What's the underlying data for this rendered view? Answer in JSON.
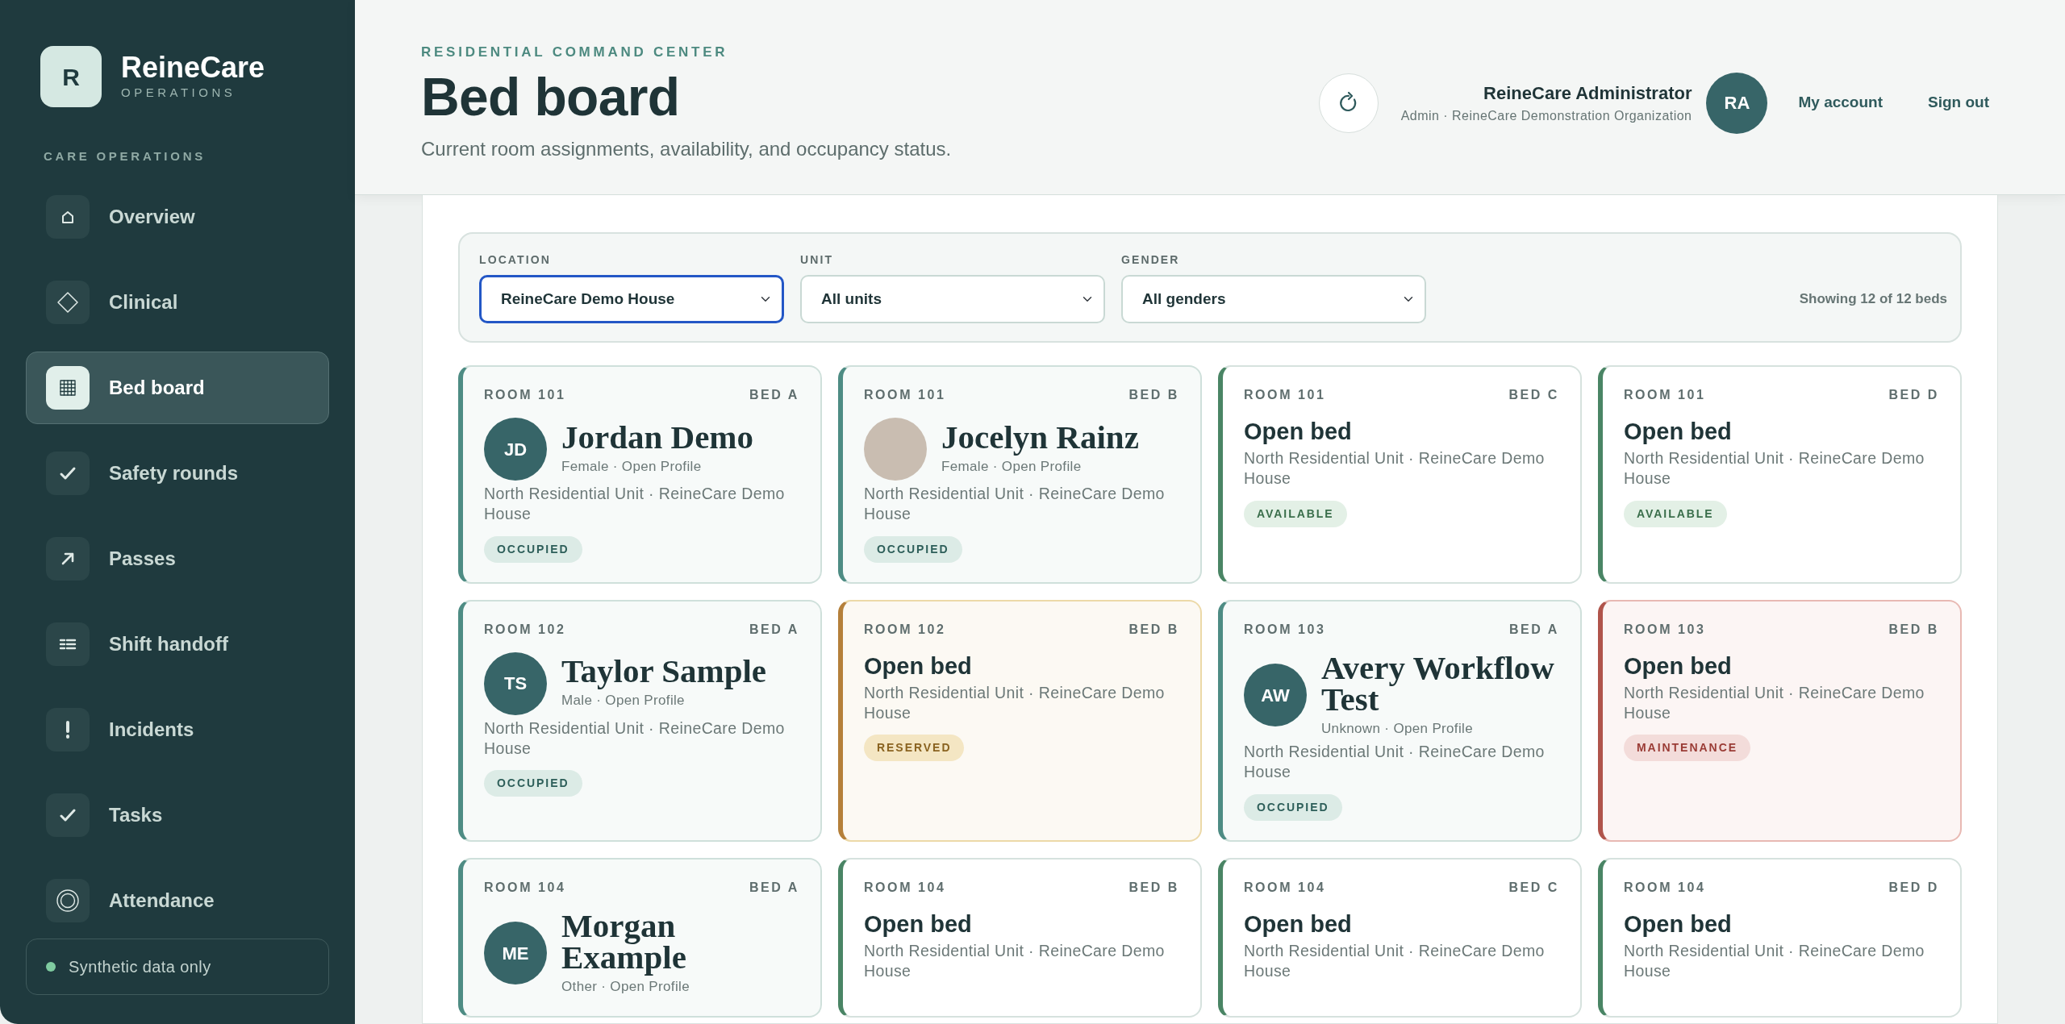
{
  "sidebar": {
    "brand": {
      "initial": "R",
      "name": "ReineCare",
      "tagline": "OPERATIONS"
    },
    "section_label": "CARE OPERATIONS",
    "items": [
      {
        "label": "Overview",
        "selected": false
      },
      {
        "label": "Clinical",
        "selected": false
      },
      {
        "label": "Bed board",
        "selected": true
      },
      {
        "label": "Safety rounds",
        "selected": false
      },
      {
        "label": "Passes",
        "selected": false
      },
      {
        "label": "Shift handoff",
        "selected": false
      },
      {
        "label": "Incidents",
        "selected": false
      },
      {
        "label": "Tasks",
        "selected": false
      },
      {
        "label": "Attendance",
        "selected": false
      }
    ],
    "footer": "Synthetic data only"
  },
  "header": {
    "eyebrow": "RESIDENTIAL COMMAND CENTER",
    "title": "Bed board",
    "subtitle": "Current room assignments, availability, and occupancy status.",
    "user": {
      "name": "ReineCare Administrator",
      "role": "Admin · ReineCare Demonstration Organization",
      "initials": "RA"
    },
    "links": [
      "My account",
      "Sign out"
    ]
  },
  "filters": [
    {
      "label": "LOCATION",
      "value": "ReineCare Demo House",
      "focused": true
    },
    {
      "label": "UNIT",
      "value": "All units",
      "focused": false
    },
    {
      "label": "GENDER",
      "value": "All genders",
      "focused": false
    }
  ],
  "count_text": "Showing 12 of 12 beds",
  "beds": [
    {
      "room": "ROOM 101",
      "bed": "BED A",
      "kind": "occupied",
      "occupant": {
        "name": "Jordan Demo",
        "details": "Female · Open Profile",
        "avatar": {
          "kind": "initials",
          "initials": "JD"
        }
      },
      "location": "North Residential Unit · ReineCare Demo House",
      "badge": "OCCUPIED"
    },
    {
      "room": "ROOM 101",
      "bed": "BED B",
      "kind": "occupied",
      "occupant": {
        "name": "Jocelyn Rainz",
        "details": "Female · Open Profile",
        "avatar": {
          "kind": "photo"
        }
      },
      "location": "North Residential Unit · ReineCare Demo House",
      "badge": "OCCUPIED"
    },
    {
      "room": "ROOM 101",
      "bed": "BED C",
      "kind": "available",
      "title": "Open bed",
      "location": "North Residential Unit · ReineCare Demo House",
      "badge": "AVAILABLE"
    },
    {
      "room": "ROOM 101",
      "bed": "BED D",
      "kind": "available",
      "title": "Open bed",
      "location": "North Residential Unit · ReineCare Demo House",
      "badge": "AVAILABLE"
    },
    {
      "room": "ROOM 102",
      "bed": "BED A",
      "kind": "occupied",
      "occupant": {
        "name": "Taylor Sample",
        "details": "Male · Open Profile",
        "avatar": {
          "kind": "initials",
          "initials": "TS"
        }
      },
      "location": "North Residential Unit · ReineCare Demo House",
      "badge": "OCCUPIED"
    },
    {
      "room": "ROOM 102",
      "bed": "BED B",
      "kind": "reserved",
      "title": "Open bed",
      "location": "North Residential Unit · ReineCare Demo House",
      "badge": "RESERVED"
    },
    {
      "room": "ROOM 103",
      "bed": "BED A",
      "kind": "occupied",
      "occupant": {
        "name": "Avery Workflow Test",
        "details": "Unknown · Open Profile",
        "avatar": {
          "kind": "initials",
          "initials": "AW"
        }
      },
      "location": "North Residential Unit · ReineCare Demo House",
      "badge": "OCCUPIED"
    },
    {
      "room": "ROOM 103",
      "bed": "BED B",
      "kind": "maintenance",
      "title": "Open bed",
      "location": "North Residential Unit · ReineCare Demo House",
      "badge": "MAINTENANCE"
    },
    {
      "room": "ROOM 104",
      "bed": "BED A",
      "kind": "occupied",
      "occupant": {
        "name": "Morgan Example",
        "details": "Other · Open Profile",
        "avatar": {
          "kind": "initials",
          "initials": "ME"
        }
      }
    },
    {
      "room": "ROOM 104",
      "bed": "BED B",
      "kind": "available",
      "title": "Open bed",
      "location": "North Residential Unit · ReineCare Demo House"
    },
    {
      "room": "ROOM 104",
      "bed": "BED C",
      "kind": "available",
      "title": "Open bed",
      "location": "North Residential Unit · ReineCare Demo House"
    },
    {
      "room": "ROOM 104",
      "bed": "BED D",
      "kind": "available",
      "title": "Open bed",
      "location": "North Residential Unit · ReineCare Demo House"
    }
  ]
}
